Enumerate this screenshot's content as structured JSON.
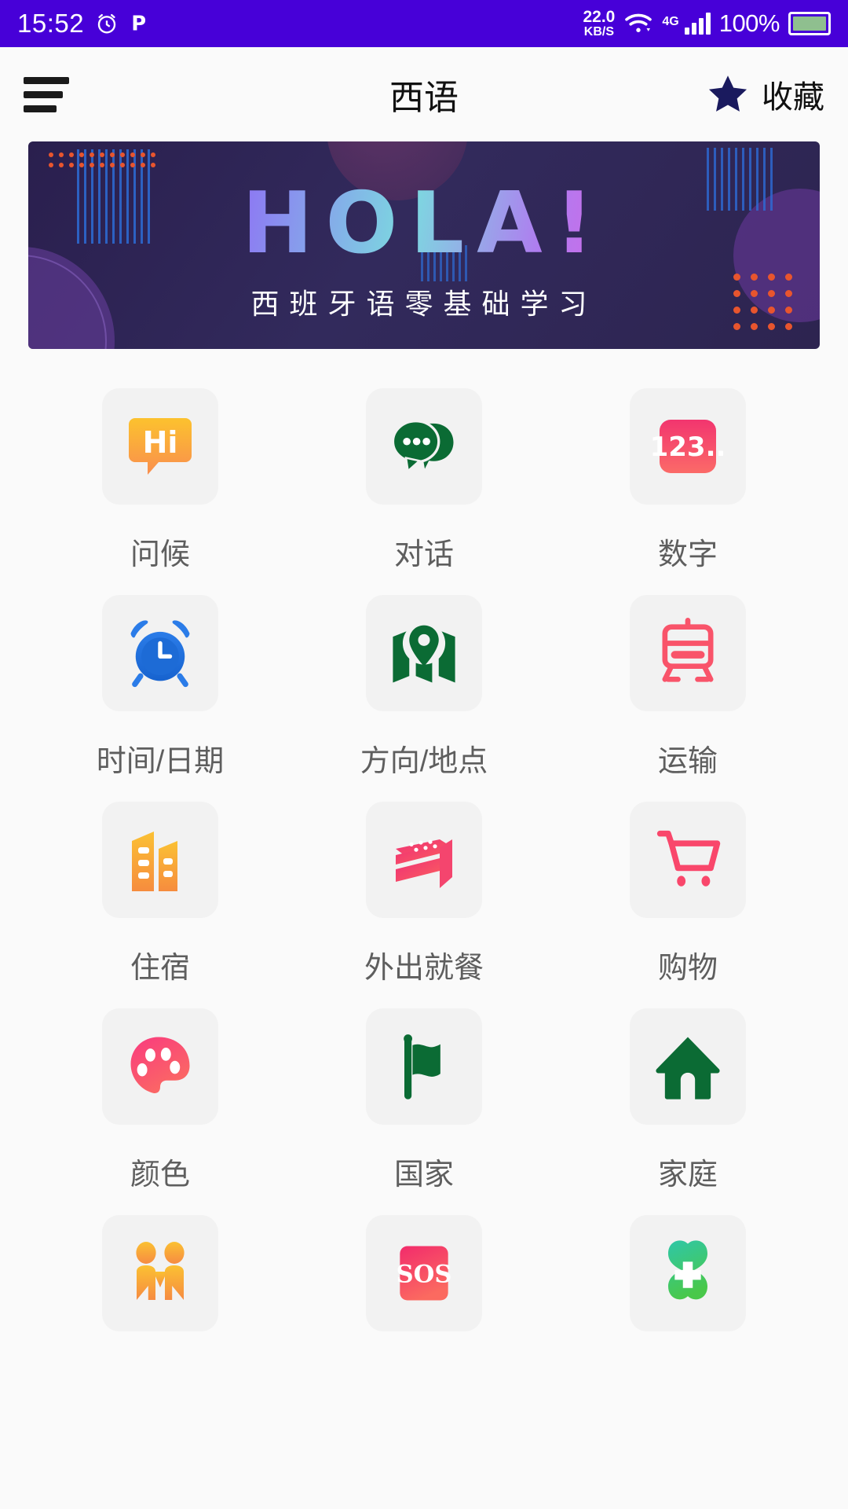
{
  "statusbar": {
    "time": "15:52",
    "alarm_icon": "alarm-clock-icon",
    "p_icon": "p-badge-icon",
    "net_speed_value": "22.0",
    "net_speed_unit": "KB/S",
    "wifi_icon": "wifi-icon",
    "network_type": "4G",
    "signal_icon": "signal-bars-icon",
    "battery_percent": "100%",
    "battery_icon": "battery-full-icon",
    "background_color": "#4700d8"
  },
  "appbar": {
    "menu_icon": "hamburger-menu-icon",
    "title": "西语",
    "favorite_icon": "star-icon",
    "favorite_label": "收藏"
  },
  "banner": {
    "headline": "HOLA!",
    "subtitle": "西班牙语零基础学习",
    "background_color": "#2d2450"
  },
  "grid": {
    "items": [
      {
        "label": "问候",
        "icon": "hi-speech-bubble-icon",
        "color": "#f8a43c"
      },
      {
        "label": "对话",
        "icon": "chat-bubbles-icon",
        "color": "#0b6b34"
      },
      {
        "label": "数字",
        "icon": "numbers-123-card-icon",
        "color": "#f5396b"
      },
      {
        "label": "时间/日期",
        "icon": "alarm-clock-icon",
        "color": "#2274e0"
      },
      {
        "label": "方向/地点",
        "icon": "map-pin-icon",
        "color": "#0b6b34"
      },
      {
        "label": "运输",
        "icon": "train-icon",
        "color": "#f9546a"
      },
      {
        "label": "住宿",
        "icon": "buildings-hotel-icon",
        "color": "#f9ad33"
      },
      {
        "label": "外出就餐",
        "icon": "cake-slice-icon",
        "color": "#f73f6e"
      },
      {
        "label": "购物",
        "icon": "shopping-cart-icon",
        "color": "#f9476b"
      },
      {
        "label": "颜色",
        "icon": "paint-palette-icon",
        "color": "#fb4d72"
      },
      {
        "label": "国家",
        "icon": "flag-icon",
        "color": "#0b6b34"
      },
      {
        "label": "家庭",
        "icon": "house-home-icon",
        "color": "#0b6b34"
      },
      {
        "label": "",
        "icon": "two-people-icon",
        "color": "#f9a93a"
      },
      {
        "label": "",
        "icon": "sos-card-icon",
        "color": "#f5396b"
      },
      {
        "label": "",
        "icon": "medical-cross-icon",
        "color": "#3ec98a"
      }
    ]
  }
}
